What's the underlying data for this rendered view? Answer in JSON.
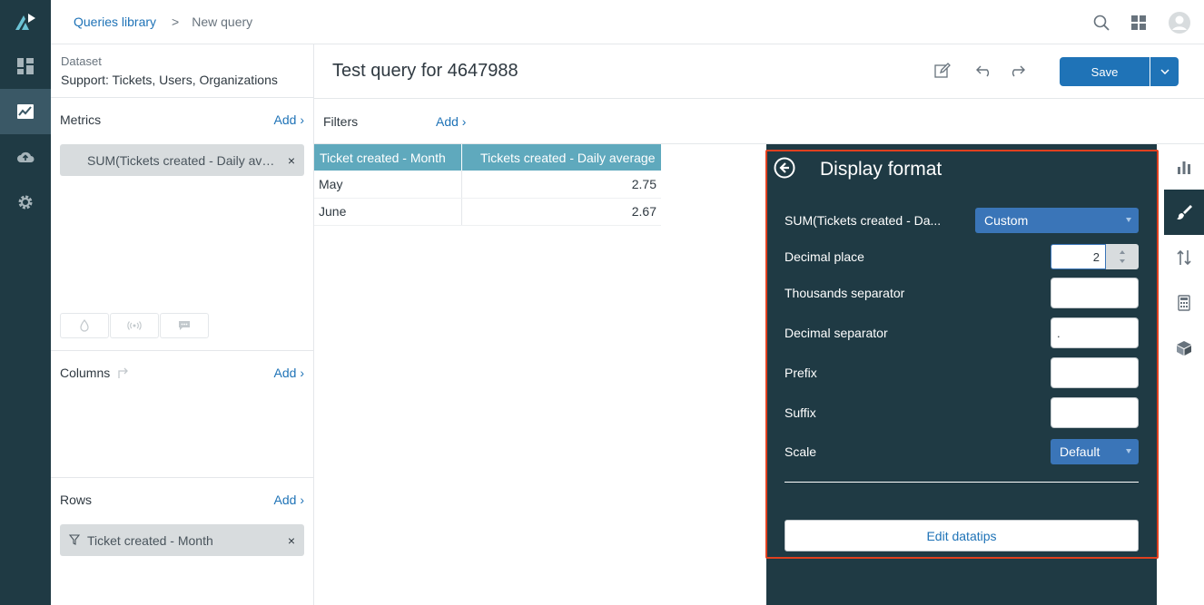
{
  "breadcrumb": {
    "library": "Queries library",
    "separator": ">",
    "current": "New query"
  },
  "dataset": {
    "label": "Dataset",
    "value": "Support: Tickets, Users, Organizations"
  },
  "metrics": {
    "title": "Metrics",
    "add": "Add ›",
    "item": "SUM(Tickets created - Daily average)",
    "remove": "×"
  },
  "columns": {
    "title": "Columns",
    "add": "Add ›"
  },
  "rows": {
    "title": "Rows",
    "add": "Add ›",
    "item": "Ticket created - Month",
    "remove": "×"
  },
  "query": {
    "title": "Test query for 4647988",
    "save_label": "Save"
  },
  "filters": {
    "label": "Filters",
    "add": "Add ›"
  },
  "table": {
    "headers": [
      "Ticket created - Month",
      "Tickets created - Daily average"
    ],
    "rows": [
      [
        "May",
        "2.75"
      ],
      [
        "June",
        "2.67"
      ]
    ]
  },
  "display_format": {
    "title": "Display format",
    "metric_label": "SUM(Tickets created - Da...",
    "metric_format": "Custom",
    "decimal_place_label": "Decimal place",
    "decimal_place_value": "2",
    "thousands_label": "Thousands separator",
    "thousands_value": "",
    "decimal_sep_label": "Decimal separator",
    "decimal_sep_value": ".",
    "prefix_label": "Prefix",
    "prefix_value": "",
    "suffix_label": "Suffix",
    "suffix_value": "",
    "scale_label": "Scale",
    "scale_value": "Default",
    "edit_datatips": "Edit datatips"
  },
  "colors": {
    "nav_bg": "#1f3a44",
    "accent": "#1f73b7",
    "header_teal": "#5fa9bd",
    "highlight": "#e0401f"
  }
}
